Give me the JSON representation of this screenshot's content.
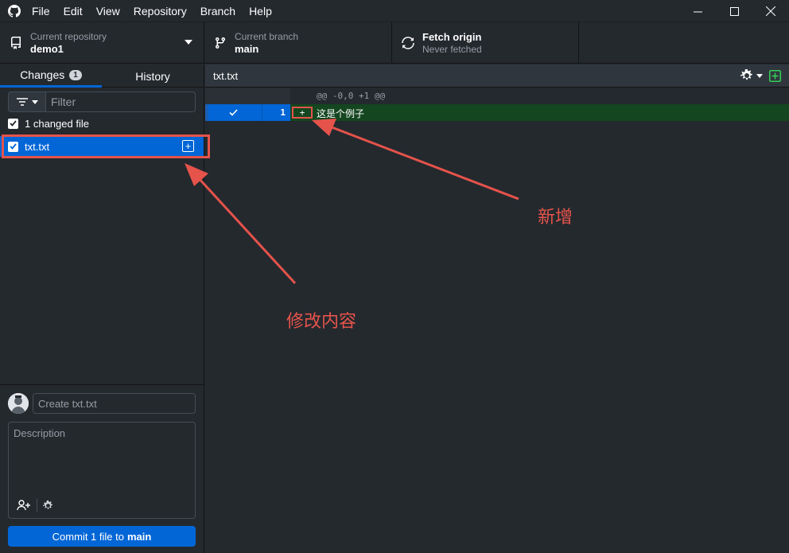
{
  "menu": {
    "file": "File",
    "edit": "Edit",
    "view": "View",
    "repository": "Repository",
    "branch": "Branch",
    "help": "Help"
  },
  "toolbar": {
    "repo_label": "Current repository",
    "repo_name": "demo1",
    "branch_label": "Current branch",
    "branch_name": "main",
    "fetch_title": "Fetch origin",
    "fetch_subtitle": "Never fetched"
  },
  "tabs": {
    "changes": "Changes",
    "changes_count": "1",
    "history": "History"
  },
  "filter": {
    "placeholder": "Filter"
  },
  "changes": {
    "summary": "1 changed file",
    "files": [
      {
        "name": "txt.txt",
        "status": "added"
      }
    ]
  },
  "commit": {
    "summary_placeholder": "Create txt.txt",
    "description_placeholder": "Description",
    "button_prefix": "Commit 1 file to",
    "button_branch": "main"
  },
  "diff": {
    "file_name": "txt.txt",
    "hunk_header": "@@ -0,0 +1 @@",
    "lines": [
      {
        "number": "1",
        "marker": "+",
        "text": "这是个例子"
      }
    ]
  },
  "annotations": {
    "modify_label": "修改内容",
    "add_label": "新增"
  },
  "colors": {
    "accent": "#0366d6",
    "annotation": "#e5534b",
    "added_line": "#144620",
    "background": "#24292e"
  }
}
